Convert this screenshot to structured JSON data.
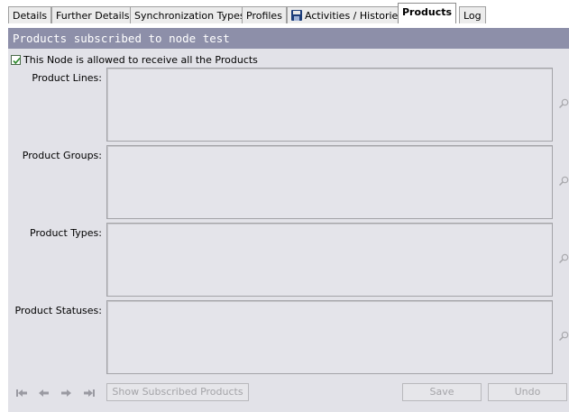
{
  "tabs": [
    {
      "label": "Details",
      "active": false
    },
    {
      "label": "Further Details",
      "active": false
    },
    {
      "label": "Synchronization Types",
      "active": false
    },
    {
      "label": "Profiles",
      "active": false
    },
    {
      "label": "Activities / Histories",
      "active": false,
      "icon": "floppy-disk-icon"
    },
    {
      "label": "Products",
      "active": true
    },
    {
      "label": "Log",
      "active": false
    }
  ],
  "panel": {
    "title": "Products subscribed to node test",
    "allow_all": {
      "label": "This Node is allowed to receive all the Products",
      "checked": true
    },
    "fields": [
      {
        "label": "Product Lines:"
      },
      {
        "label": "Product Groups:"
      },
      {
        "label": "Product Types:"
      },
      {
        "label": "Product Statuses:"
      }
    ]
  },
  "footer": {
    "nav_icons": [
      "first-record-icon",
      "previous-record-icon",
      "next-record-icon",
      "last-record-icon"
    ],
    "show_subscribed_label": "Show Subscribed Products",
    "save_label": "Save",
    "undo_label": "Undo"
  },
  "colors": {
    "header_bg": "#8d8fa9",
    "panel_bg": "#e2e2e8",
    "checkbox_tick": "#2f8a2f"
  }
}
